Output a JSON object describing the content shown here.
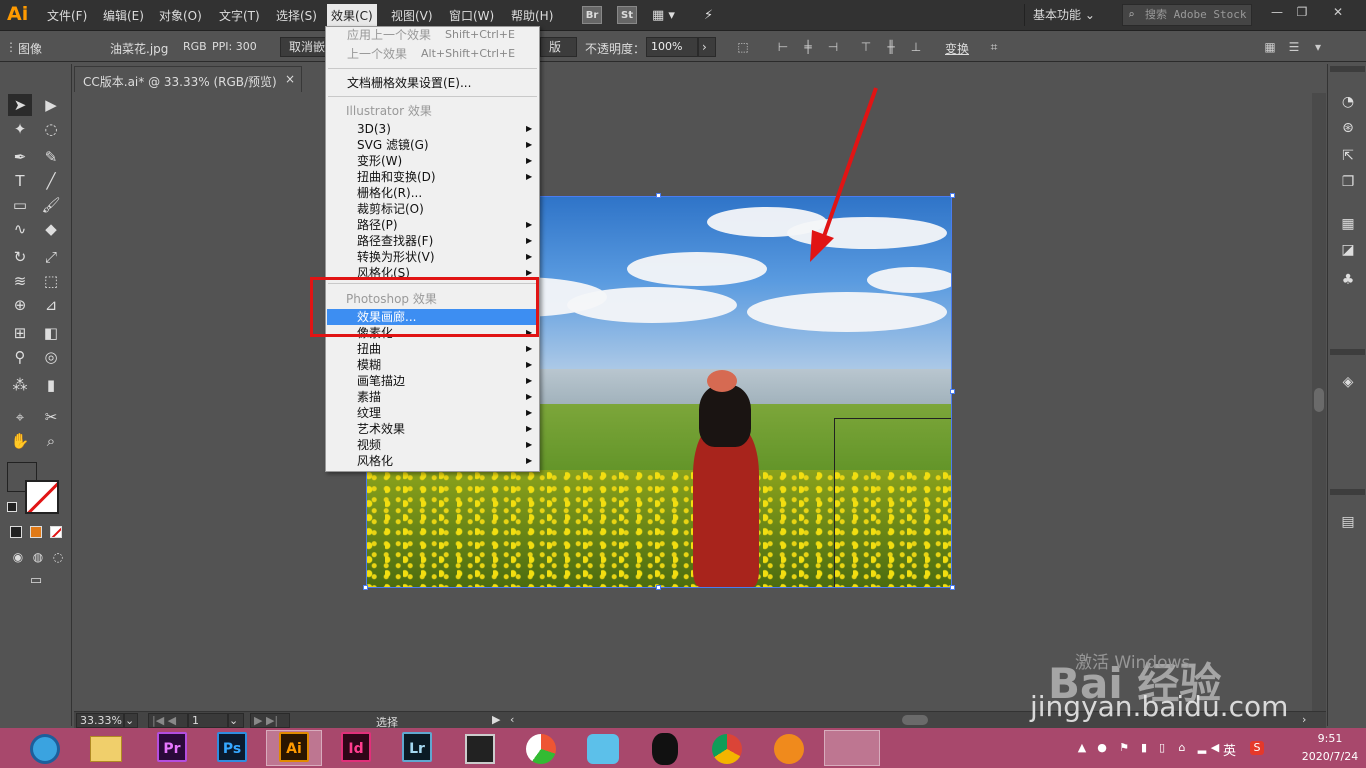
{
  "menubar": {
    "logo": "Ai",
    "items": [
      "文件(F)",
      "编辑(E)",
      "对象(O)",
      "文字(T)",
      "选择(S)",
      "效果(C)",
      "视图(V)",
      "窗口(W)",
      "帮助(H)"
    ],
    "active_item": "效果(C)",
    "bridge": "Br",
    "stock": "St",
    "workspace": "基本功能",
    "search_placeholder": "搜索 Adobe Stock"
  },
  "controlbar": {
    "object_type": "图像",
    "file_name": "油菜花.jpg",
    "color_mode": "RGB",
    "ppi": "PPI: 300",
    "unembed_button": "取消嵌",
    "partial_button": "版",
    "opacity_label": "不透明度：",
    "opacity_value": "100%",
    "transform_label": "变换"
  },
  "document_tab": {
    "title": "CC版本.ai* @ 33.33% (RGB/预览)",
    "close": "×"
  },
  "effect_menu": {
    "items": [
      {
        "label": "应用上一个效果",
        "shortcut": "Shift+Ctrl+E",
        "disabled": true
      },
      {
        "label": "上一个效果",
        "shortcut": "Alt+Shift+Ctrl+E",
        "disabled": true
      },
      {
        "label": "文档栅格效果设置(E)...",
        "shortcut": "",
        "disabled": false
      }
    ],
    "illustrator_header": "Illustrator 效果",
    "illustrator_items": [
      {
        "label": "3D(3)",
        "submenu": true
      },
      {
        "label": "SVG 滤镜(G)",
        "submenu": true
      },
      {
        "label": "变形(W)",
        "submenu": true
      },
      {
        "label": "扭曲和变换(D)",
        "submenu": true
      },
      {
        "label": "栅格化(R)...",
        "submenu": false
      },
      {
        "label": "裁剪标记(O)",
        "submenu": false
      },
      {
        "label": "路径(P)",
        "submenu": true
      },
      {
        "label": "路径查找器(F)",
        "submenu": true
      },
      {
        "label": "转换为形状(V)",
        "submenu": true
      },
      {
        "label": "风格化(S)",
        "submenu": true
      }
    ],
    "photoshop_header": "Photoshop 效果",
    "photoshop_items": [
      {
        "label": "效果画廊...",
        "submenu": false,
        "highlighted": true
      },
      {
        "label": "像素化",
        "submenu": true
      },
      {
        "label": "扭曲",
        "submenu": true
      },
      {
        "label": "模糊",
        "submenu": true
      },
      {
        "label": "画笔描边",
        "submenu": true
      },
      {
        "label": "素描",
        "submenu": true
      },
      {
        "label": "纹理",
        "submenu": true
      },
      {
        "label": "艺术效果",
        "submenu": true
      },
      {
        "label": "视频",
        "submenu": true
      },
      {
        "label": "风格化",
        "submenu": true
      }
    ]
  },
  "statusbar": {
    "zoom": "33.33%",
    "artboard": "1",
    "mode": "选择"
  },
  "watermark": {
    "activate_text": "激活 Windows",
    "baidu_text": "Bai 经验",
    "url": "jingyan.baidu.com"
  },
  "taskbar": {
    "apps": [
      "Pr",
      "Ps",
      "Ai",
      "Id",
      "Lr"
    ],
    "language": "英",
    "time": "9:51",
    "date": "2020/7/24"
  },
  "colors": {
    "menu_highlight": "#3d8ef2",
    "annotation_red": "#e11414",
    "taskbar": "#a8486c",
    "ai_orange": "#ff9a00"
  }
}
